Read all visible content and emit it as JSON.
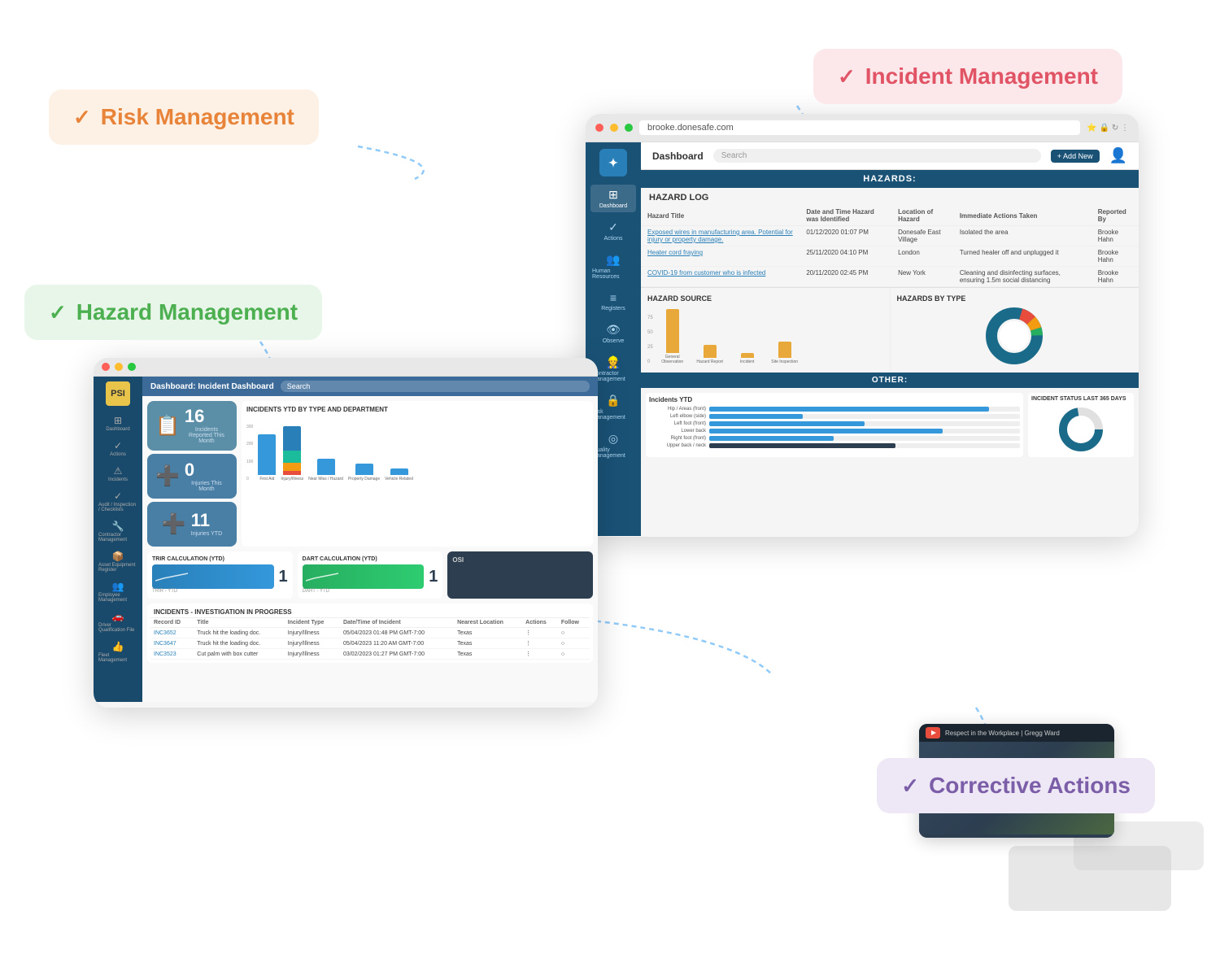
{
  "features": {
    "risk_management": {
      "label": "Risk Management",
      "check": "✓",
      "bg": "#fdf0e4",
      "color": "#e8843a"
    },
    "incident_management": {
      "label": "Incident Management",
      "check": "✓",
      "bg": "#fce8ea",
      "color": "#e05465"
    },
    "hazard_management": {
      "label": "Hazard Management",
      "check": "✓",
      "bg": "#e8f5e9",
      "color": "#4caf50"
    },
    "corrective_actions": {
      "label": "Corrective Actions",
      "check": "✓",
      "bg": "#ede7f6",
      "color": "#7b5ea7"
    }
  },
  "hazard_browser": {
    "url": "brooke.donesafe.com",
    "title": "Dashboard",
    "search_placeholder": "Search",
    "add_new": "+ Add New",
    "section_title": "HAZARDS:",
    "other_section": "OTHER:",
    "log_title": "HAZARD LOG",
    "table_headers": [
      "Hazard Title",
      "Date and Time Hazard was Identified",
      "Location of Hazard",
      "Immediate Actions Taken",
      "Reported By"
    ],
    "table_rows": [
      {
        "title": "Exposed wires in manufacturing area. Potential for injury or property damage.",
        "date": "01/12/2020 01:07 PM",
        "location": "Donesafe East Village",
        "action": "Isolated the area",
        "reporter": "Brooke Hahn"
      },
      {
        "title": "Heater cord fraying",
        "date": "25/11/2020 04:10 PM",
        "location": "London",
        "action": "Turned healer off and unplugged it",
        "reporter": "Brooke Hahn"
      },
      {
        "title": "COVID-19 from customer who is infected",
        "date": "20/11/2020 02:45 PM",
        "location": "New York",
        "action": "Cleaning and disinfecting surfaces, ensuring 1.5m social distancing",
        "reporter": "Brooke Hahn"
      }
    ],
    "hazard_source_title": "HAZARD SOURCE",
    "hazard_source_bars": [
      {
        "label": "General Observation",
        "value": 75,
        "color": "#e8a83a"
      },
      {
        "label": "Hazard Report",
        "value": 20,
        "color": "#e8a83a"
      },
      {
        "label": "Incident",
        "value": 8,
        "color": "#e8a83a"
      },
      {
        "label": "Site Inspection",
        "value": 28,
        "color": "#e8a83a"
      }
    ],
    "hazard_by_type_title": "HAZARDS BY TYPE",
    "sidebar_items": [
      "Dashboard",
      "Actions",
      "Human Resources",
      "Registers",
      "Observe",
      "Contractor Management",
      "Risk Management",
      "Quality Management"
    ]
  },
  "incident_browser": {
    "title": "Dashboard: Incident Dashboard",
    "search_placeholder": "Search",
    "logo_text": "PSI",
    "chart_title": "INCIDENTS YTD BY TYPE AND DEPARTMENT",
    "kpis": [
      {
        "number": "16",
        "label": "Incidents Reported This Month",
        "icon": "📋"
      },
      {
        "number": "0",
        "label": "Injuries This Month",
        "icon": "➕"
      },
      {
        "number": "11",
        "label": "Injuries YTD",
        "icon": "➕"
      }
    ],
    "trir_title": "TRIR CALCULATION (YTD)",
    "trir_value": "1",
    "dart_title": "DART CALCULATION (YTD)",
    "dart_value": "1",
    "incidents_table_title": "INCIDENTS - INVESTIGATION IN PROGRESS",
    "incidents_table_headers": [
      "Record ID",
      "Title",
      "Incident Type",
      "Date/Time of Incident",
      "Nearest Location",
      "Actions",
      "Follow"
    ],
    "incidents_rows": [
      {
        "id": "INC3652",
        "title": "Truck hit the loading doc.",
        "type": "Injury/Illness",
        "date": "05/04/2023 01:48 PM GMT-7:00",
        "location": "Texas"
      },
      {
        "id": "INC3647",
        "title": "Truck hit the loading doc.",
        "type": "Injury/Illness",
        "date": "05/04/2023 11:20 AM GMT-7:00",
        "location": "Texas"
      },
      {
        "id": "INC3523",
        "title": "Cut palm with box cutter",
        "type": "Injury/Illness",
        "date": "03/02/2023 01:27 PM GMT-7:00",
        "location": "Texas"
      }
    ],
    "sidebar_items": [
      "Dashboard",
      "Actions",
      "Incidents",
      "Audit / Inspection / Checklists",
      "Contractor Management",
      "Asset Equipment Register",
      "Employee Management",
      "Driver Qualification File (DQF)",
      "Fleet Management"
    ]
  },
  "video": {
    "title": "Respect in the Workplace | Gregg Ward",
    "logo_color": "#e74c3c"
  }
}
